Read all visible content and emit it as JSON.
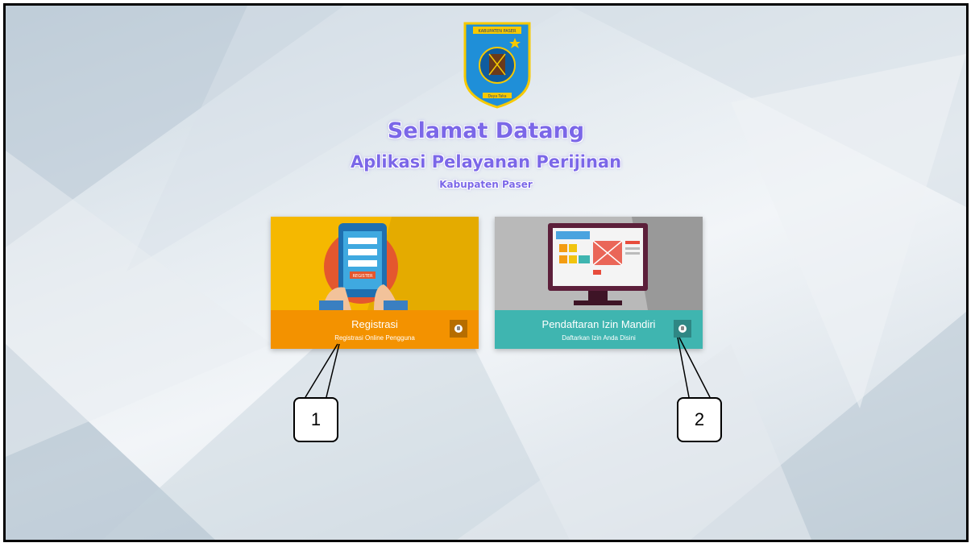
{
  "header": {
    "welcome": "Selamat Datang",
    "app_name": "Aplikasi Pelayanan Perijinan",
    "region": "Kabupaten Paser"
  },
  "logo": {
    "banner_text": "KABUPATEN PASER",
    "motto": "Daya Taka"
  },
  "cards": [
    {
      "title": "Registrasi",
      "subtitle": "Registrasi Online Pengguna",
      "illustration_label": "REGISTER",
      "icon": "globe-icon",
      "color": "#f39200"
    },
    {
      "title": "Pendaftaran Izin Mandiri",
      "subtitle": "Daftarkan Izin Anda Disini",
      "icon": "globe-icon",
      "color": "#3fb5b0"
    }
  ],
  "callouts": [
    "1",
    "2"
  ]
}
